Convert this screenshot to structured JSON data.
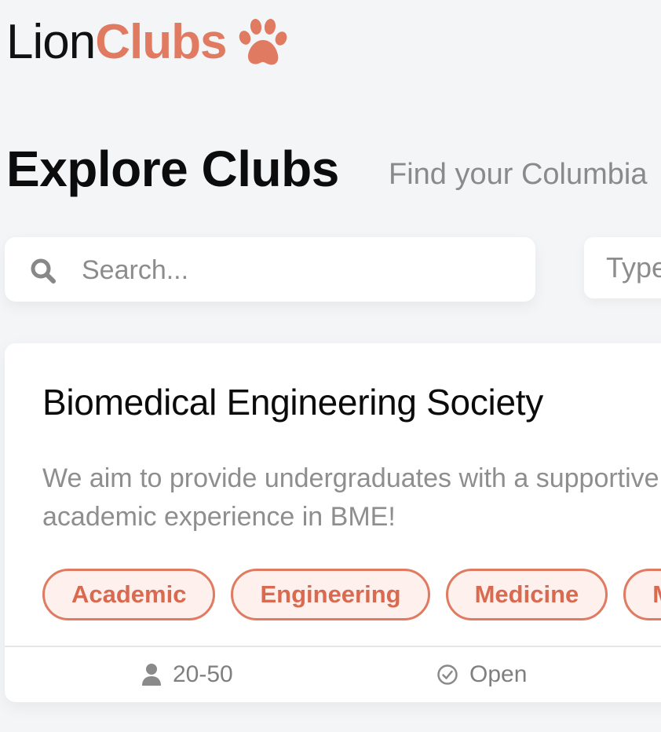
{
  "logo": {
    "part1": "Lion",
    "part2": "Clubs",
    "icon": "paw-icon",
    "accent_color": "#e07a61"
  },
  "page": {
    "title": "Explore Clubs",
    "subtitle": "Find your Columbia"
  },
  "search": {
    "placeholder": "Search...",
    "value": "",
    "icon": "search-icon"
  },
  "filter": {
    "type_label": "Type"
  },
  "club": {
    "name": "Biomedical Engineering Society",
    "description": "We aim to provide undergraduates with a supportive academic experience in BME!",
    "tags": [
      "Academic",
      "Engineering",
      "Medicine",
      "Me"
    ],
    "members": "20-50",
    "members_icon": "user-icon",
    "status": "Open",
    "status_icon": "check-circle-icon"
  }
}
